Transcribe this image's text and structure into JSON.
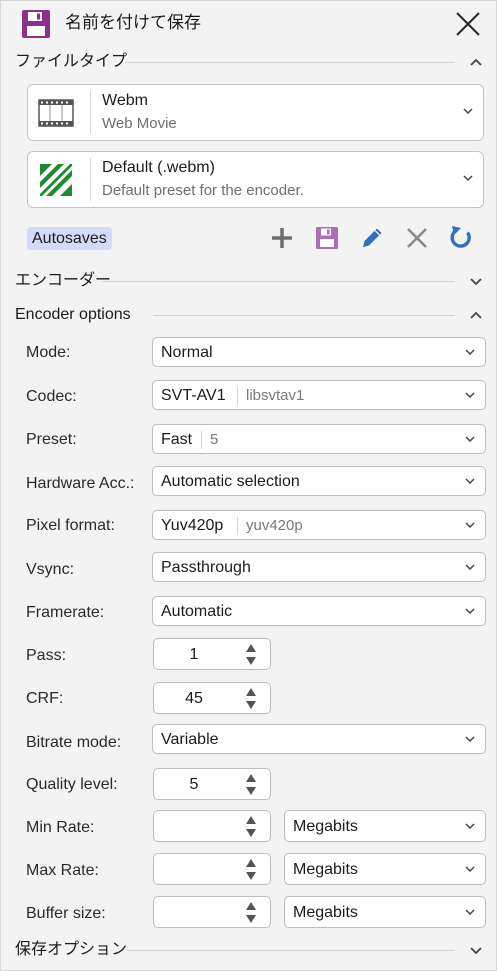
{
  "window": {
    "title": "名前を付けて保存"
  },
  "sections": {
    "file_type": "ファイルタイプ",
    "encoder": "エンコーダー",
    "encoder_options": "Encoder options",
    "save_options": "保存オプション"
  },
  "file_type_card": {
    "name": "Webm",
    "description": "Web Movie",
    "icon": "film-strip-icon"
  },
  "preset_card": {
    "name": "Default (.webm)",
    "description": "Default preset for the encoder.",
    "icon": "ffmpeg-logo-icon"
  },
  "autosaves": {
    "label": "Autosaves"
  },
  "toolbar_icons": [
    "add-icon",
    "save-icon",
    "edit-icon",
    "delete-icon",
    "reset-icon"
  ],
  "options": {
    "mode": {
      "label": "Mode:",
      "value": "Normal"
    },
    "codec": {
      "label": "Codec:",
      "value": "SVT-AV1",
      "detail": "libsvtav1"
    },
    "preset": {
      "label": "Preset:",
      "value": "Fast",
      "detail": "5"
    },
    "hwaccel": {
      "label": "Hardware Acc.:",
      "value": "Automatic selection"
    },
    "pixel_format": {
      "label": "Pixel format:",
      "value": "Yuv420p",
      "detail": "yuv420p"
    },
    "vsync": {
      "label": "Vsync:",
      "value": "Passthrough"
    },
    "framerate": {
      "label": "Framerate:",
      "value": "Automatic"
    },
    "pass": {
      "label": "Pass:",
      "value": "1"
    },
    "crf": {
      "label": "CRF:",
      "value": "45"
    },
    "bitrate_mode": {
      "label": "Bitrate mode:",
      "value": "Variable"
    },
    "quality_level": {
      "label": "Quality level:",
      "value": "5"
    },
    "min_rate": {
      "label": "Min Rate:",
      "value": "",
      "unit": "Megabits"
    },
    "max_rate": {
      "label": "Max Rate:",
      "value": "",
      "unit": "Megabits"
    },
    "buffer_size": {
      "label": "Buffer size:",
      "value": "",
      "unit": "Megabits"
    }
  },
  "colors": {
    "accent_purple": "#8e2f8e",
    "icon_blue": "#2d70c4",
    "icon_gray": "#777777",
    "autosave_bg": "#d6dafa"
  }
}
